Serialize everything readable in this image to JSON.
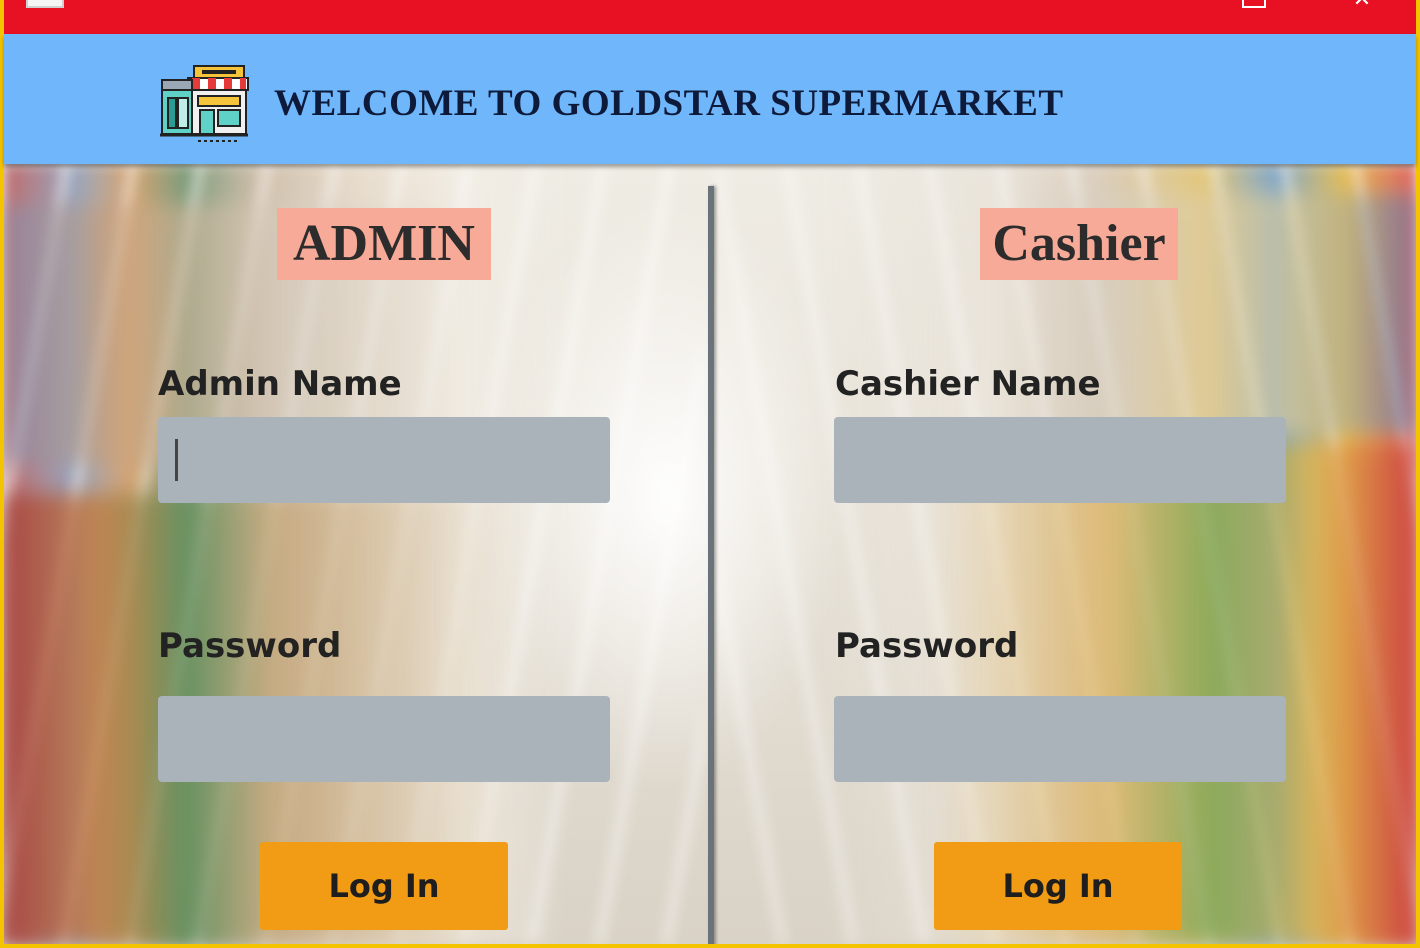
{
  "window": {
    "title_icon": "app-icon",
    "maximize_icon": "maximize-icon",
    "close_icon": "close-icon",
    "close_glyph": "✕"
  },
  "header": {
    "logo_icon": "store-icon",
    "title": "WELCOME TO GOLDSTAR SUPERMARKET"
  },
  "admin": {
    "title": "ADMIN",
    "name_label": "Admin Name",
    "name_value": "",
    "password_label": "Password",
    "password_value": "",
    "login_label": "Log In"
  },
  "cashier": {
    "title": "Cashier",
    "name_label": "Cashier Name",
    "name_value": "",
    "password_label": "Password",
    "password_value": "",
    "login_label": "Log In"
  },
  "colors": {
    "titlebar": "#e81123",
    "header": "#6fb6fb",
    "frame": "#f5c400",
    "title_highlight": "#f7aa98",
    "input_bg": "#aab3ba",
    "button": "#f29b14"
  }
}
